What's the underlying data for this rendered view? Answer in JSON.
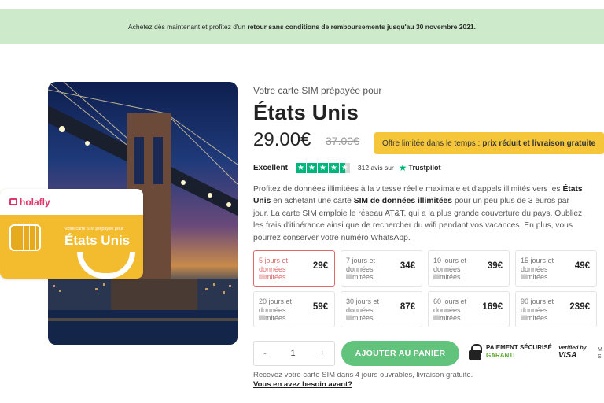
{
  "banner": {
    "text_before": "Achetez dès maintenant et profitez d'un",
    "text_bold": "retour sans conditions de remboursements jusqu'au 30 novembre 2021."
  },
  "sim_card": {
    "brand": "holafly",
    "small_caption": "Votre carte SIM prépayée pour",
    "title": "États Unis"
  },
  "product": {
    "subtitle": "Votre carte SIM prépayée pour",
    "title": "États Unis",
    "price": "29.00€",
    "old_price": "37.00€",
    "offer_prefix": "Offre limitée dans le temps :",
    "offer_bold": "prix réduit et livraison gratuite"
  },
  "rating": {
    "label": "Excellent",
    "stars": 4.5,
    "reviews": "312 avis sur",
    "trustpilot": "Trustpilot"
  },
  "description": {
    "p1": "Profitez de données illimitées à la vitesse réelle maximale et d'appels illimités vers les",
    "b1": "États Unis",
    "p2": "en achetant une carte",
    "b2": "SIM de données illimitées",
    "p3": "pour un peu plus de 3 euros par jour. La carte SIM emploie le réseau AT&T, qui a la plus grande couverture du pays. Oubliez les frais d'itinérance ainsi que de rechercher du wifi pendant vos vacances. En plus, vous pourrez conserver votre numéro WhatsApp."
  },
  "plans": [
    {
      "label": "5 jours et données illimitées",
      "price": "29€",
      "selected": true
    },
    {
      "label": "7 jours et données illimitées",
      "price": "34€",
      "selected": false
    },
    {
      "label": "10 jours et données illimitées",
      "price": "39€",
      "selected": false
    },
    {
      "label": "15 jours et données illimitées",
      "price": "49€",
      "selected": false
    },
    {
      "label": "20 jours et données illimitées",
      "price": "59€",
      "selected": false
    },
    {
      "label": "30 jours et données illimitées",
      "price": "87€",
      "selected": false
    },
    {
      "label": "60 jours et données illimitées",
      "price": "169€",
      "selected": false
    },
    {
      "label": "90 jours et données illimitées",
      "price": "239€",
      "selected": false
    }
  ],
  "cart": {
    "minus": "-",
    "quantity": "1",
    "plus": "+",
    "add_label": "AJOUTER AU PANIER"
  },
  "security": {
    "line1": "PAIEMENT SÉCURISÉ",
    "line2": "GARANTI",
    "visa_top": "Verified by",
    "visa_bottom": "VISA",
    "mc_line1": "M",
    "mc_line2": "S"
  },
  "shipping": {
    "delivery": "Recevez votre carte SIM dans 4 jours ouvrables, livraison gratuite.",
    "need_link": "Vous en avez besoin avant?"
  },
  "colors": {
    "banner_bg": "#cdeacb",
    "offer_bg": "#f6c63a",
    "trustpilot_green": "#00b67a",
    "cta_green": "#62c37d",
    "selected_border": "#e06a6a",
    "sim_yellow": "#f3bb2e",
    "brand_pink": "#e0366b"
  },
  "icons": [
    "lock-icon",
    "trustpilot-star-icon",
    "sim-chip-icon",
    "holafly-logo-icon"
  ]
}
